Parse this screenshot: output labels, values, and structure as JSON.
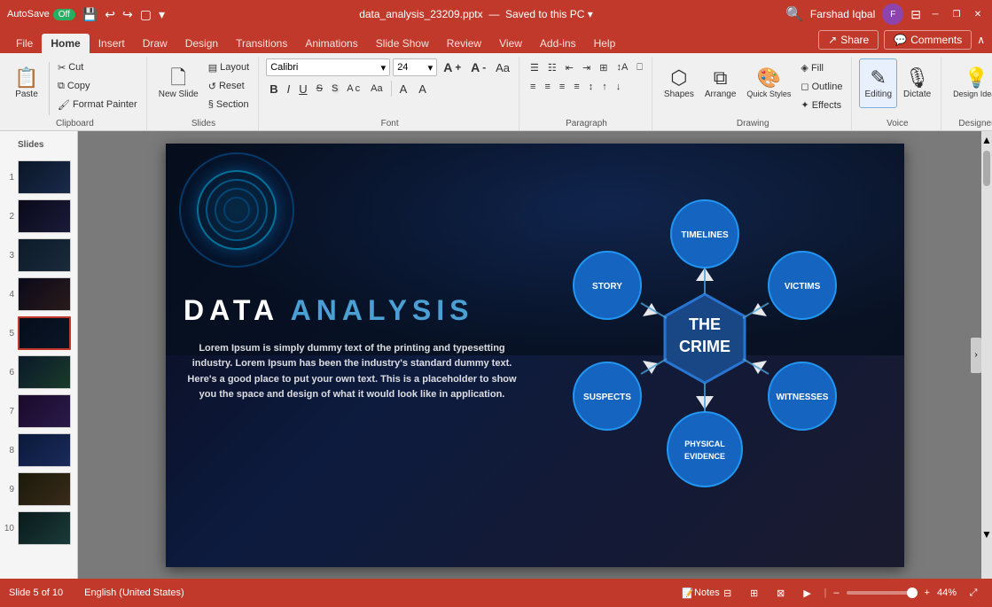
{
  "titlebar": {
    "autosave_label": "AutoSave",
    "toggle_label": "Off",
    "filename": "data_analysis_23209.pptx",
    "saved_label": "Saved to this PC",
    "search_placeholder": "Search",
    "user_name": "Farshad Iqbal",
    "minimize_label": "─",
    "restore_label": "❐",
    "close_label": "✕"
  },
  "ribbon_tabs": {
    "tabs": [
      "File",
      "Home",
      "Insert",
      "Draw",
      "Design",
      "Transitions",
      "Animations",
      "Slide Show",
      "Review",
      "View",
      "Add-ins",
      "Help"
    ],
    "active": "Home"
  },
  "ribbon": {
    "groups": {
      "clipboard": {
        "label": "Clipboard",
        "paste": "Paste",
        "cut": "Cut",
        "copy": "Copy",
        "format_painter": "Format Painter"
      },
      "slides": {
        "label": "Slides",
        "new_slide": "New Slide",
        "layout": "Layout",
        "reset": "Reset",
        "section": "Section"
      },
      "font": {
        "label": "Font",
        "font_name": "Calibri",
        "font_size": "24",
        "bold": "B",
        "italic": "I",
        "underline": "U",
        "strikethrough": "S",
        "shadow": "S",
        "char_spacing": "Ac",
        "change_case": "Aa",
        "font_color": "A",
        "highlight": "A"
      },
      "paragraph": {
        "label": "Paragraph"
      },
      "drawing": {
        "label": "Drawing",
        "shapes": "Shapes",
        "arrange": "Arrange",
        "quick_styles": "Quick Styles",
        "shape_fill": "Shape Fill",
        "shape_outline": "Shape Outline",
        "shape_effects": "Shape Effects"
      },
      "voice": {
        "label": "Voice",
        "editing": "Editing",
        "dictate": "Dictate"
      },
      "designer": {
        "label": "Designer",
        "design_ideas": "Design Ideas"
      }
    }
  },
  "slides_panel": {
    "slides": [
      {
        "num": 1,
        "thumb_class": "t1"
      },
      {
        "num": 2,
        "thumb_class": "t2"
      },
      {
        "num": 3,
        "thumb_class": "t3"
      },
      {
        "num": 4,
        "thumb_class": "t4"
      },
      {
        "num": 5,
        "thumb_class": "t5",
        "active": true
      },
      {
        "num": 6,
        "thumb_class": "t6"
      },
      {
        "num": 7,
        "thumb_class": "t7"
      },
      {
        "num": 8,
        "thumb_class": "t8"
      },
      {
        "num": 9,
        "thumb_class": "t9"
      },
      {
        "num": 10,
        "thumb_class": "t10"
      }
    ]
  },
  "slide": {
    "title_white": "DATA ",
    "title_accent": "ANALYSIS",
    "body_text": "Lorem Ipsum is simply dummy text of the printing and typesetting industry. Lorem Ipsum has been the industry's standard dummy text. Here's a good place to put your own text. This is a placeholder to show you the space and design of what it would look like in application.",
    "diagram": {
      "center": "THE CRIME",
      "nodes": [
        "TIMELINES",
        "VICTIMS",
        "WITNESSES",
        "PHYSICAL EVIDENCE",
        "SUSPECTS",
        "STORY"
      ]
    }
  },
  "statusbar": {
    "slide_info": "Slide 5 of 10",
    "language": "English (United States)",
    "notes_label": "Notes",
    "zoom_percent": "44%",
    "zoom_value": 44
  }
}
